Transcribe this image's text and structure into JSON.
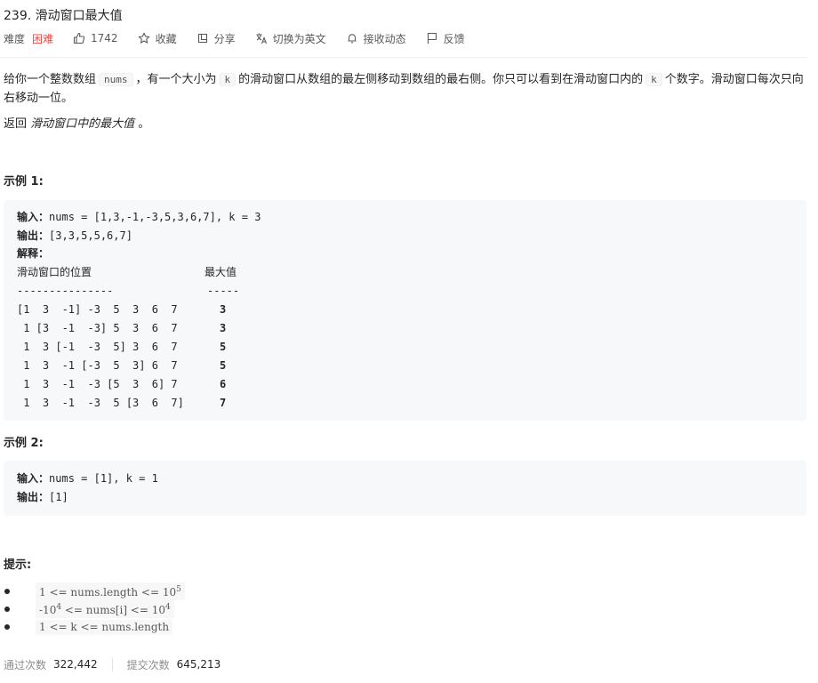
{
  "problem": {
    "title": "239. 滑动窗口最大值",
    "difficulty_label": "难度",
    "difficulty": "困难",
    "likes": "1742",
    "collect": "收藏",
    "share": "分享",
    "switch_lang": "切换为英文",
    "notify": "接收动态",
    "feedback": "反馈"
  },
  "description": {
    "p1_a": "给你一个整数数组",
    "p1_code1": "nums",
    "p1_b": "，有一个大小为",
    "p1_code2": "k",
    "p1_c": "的滑动窗口从数组的最左侧移动到数组的最右侧。你只可以看到在滑动窗口内的",
    "p1_code3": "k",
    "p1_d": "个数字。滑动窗口每次只向右移动一位。",
    "p2_a": "返回",
    "p2_i": "滑动窗口中的最大值",
    "p2_b": "。"
  },
  "example1": {
    "title": "示例 1:",
    "input_label": "输入：",
    "input": "nums = [1,3,-1,-3,5,3,6,7], k = 3",
    "output_label": "输出：",
    "output": "[3,3,5,5,6,7]",
    "explain_label": "解释：",
    "header_left": "滑动窗口的位置",
    "header_right": "最大值",
    "rule_left": "---------------",
    "rule_right": "-----",
    "rows": [
      {
        "window": "[1  3  -1] -3  5  3  6  7",
        "max": "3"
      },
      {
        "window": " 1 [3  -1  -3] 5  3  6  7",
        "max": "3"
      },
      {
        "window": " 1  3 [-1  -3  5] 3  6  7",
        "max": "5"
      },
      {
        "window": " 1  3  -1 [-3  5  3] 6  7",
        "max": "5"
      },
      {
        "window": " 1  3  -1  -3 [5  3  6] 7",
        "max": "6"
      },
      {
        "window": " 1  3  -1  -3  5 [3  6  7]",
        "max": "7"
      }
    ]
  },
  "example2": {
    "title": "示例 2:",
    "input_label": "输入：",
    "input": "nums = [1], k = 1",
    "output_label": "输出：",
    "output": "[1]"
  },
  "hints": {
    "title": "提示:",
    "h1_a": "1 <= nums.length <= 10",
    "h1_sup": "5",
    "h2_a": "-10",
    "h2_sup1": "4",
    "h2_b": " <= nums[i] <= 10",
    "h2_sup2": "4",
    "h3": "1 <= k <= nums.length"
  },
  "stats": {
    "passed_label": "通过次数",
    "passed": "322,442",
    "submitted_label": "提交次数",
    "submitted": "645,213"
  },
  "colors": {
    "difficulty_hard": "#ef4743",
    "code_bg": "#f7f8fa"
  }
}
